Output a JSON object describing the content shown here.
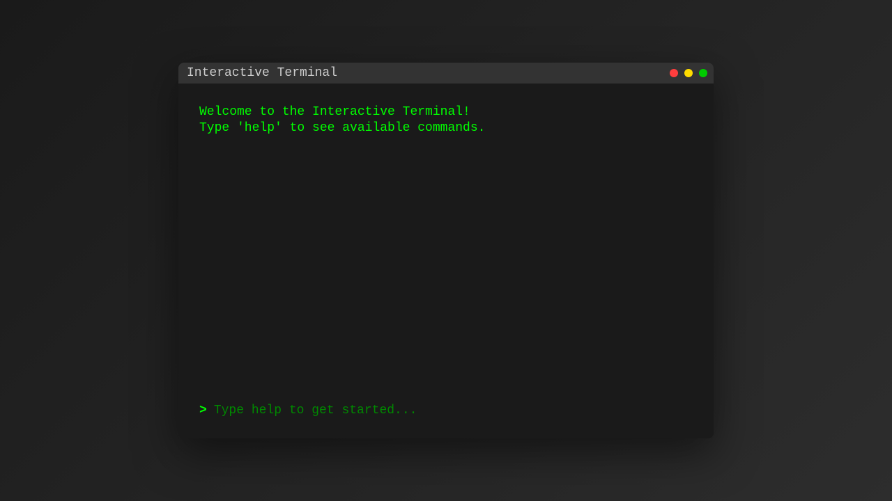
{
  "header": {
    "title": "Interactive Terminal"
  },
  "colors": {
    "close": "#ff3e3e",
    "minimize": "#ffdc00",
    "maximize": "#00cc00",
    "text_primary": "#00ff00",
    "placeholder": "#008800",
    "background": "#1a1a1a",
    "header_bg": "#333333"
  },
  "output": {
    "lines": [
      "Welcome to the Interactive Terminal!",
      "Type 'help' to see available commands."
    ]
  },
  "input": {
    "prompt": ">",
    "value": "",
    "placeholder": "Type help to get started..."
  }
}
